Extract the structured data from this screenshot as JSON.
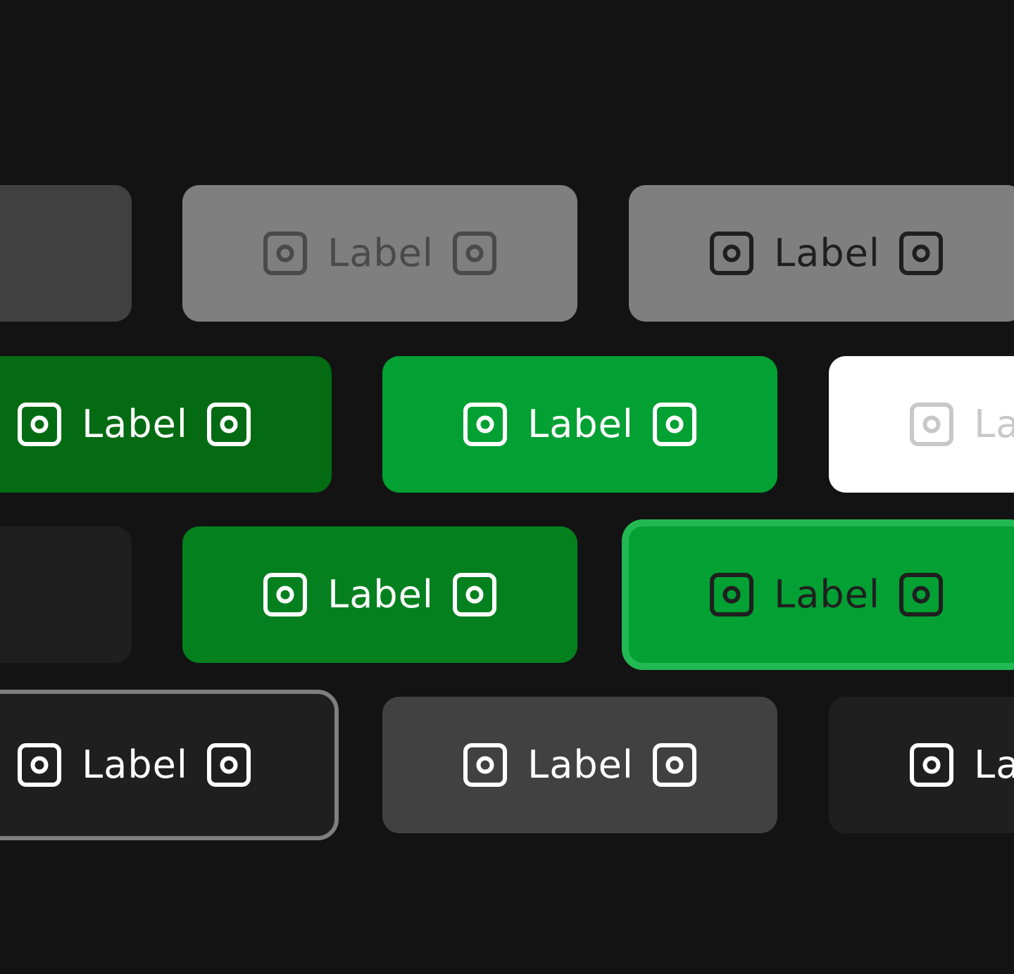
{
  "theme": {
    "background": "#131313",
    "brand_green": "#03a033",
    "brand_green_hover": "#04801f",
    "brand_green_pressed": "#046b13",
    "focus_ring": "#22b853",
    "neutral_disabled": "#7f7f7f",
    "neutral_secondary": "#414141",
    "neutral_tertiary": "#1f1f1f"
  },
  "buttons": [
    {
      "label": "",
      "bg": "#414141",
      "fg": "#cccccc",
      "icon": "square-dot-icon"
    },
    {
      "label": "Label",
      "bg": "#7f7f7f",
      "fg": "#4a4a4a",
      "icon": "square-dot-icon"
    },
    {
      "label": "Label",
      "bg": "#7f7f7f",
      "fg": "#1f1f1f",
      "icon": "square-dot-icon"
    },
    {
      "label": "Label",
      "bg": "#046b13",
      "fg": "#ffffff",
      "icon": "square-dot-icon"
    },
    {
      "label": "Label",
      "bg": "#03a033",
      "fg": "#ffffff",
      "icon": "square-dot-icon"
    },
    {
      "label": "Label",
      "bg": "#ffffff",
      "fg": "#c8c8c8",
      "icon": "square-dot-icon"
    },
    {
      "label": "",
      "bg": "#1f1f1f",
      "fg": "#414141",
      "icon": "square-dot-icon"
    },
    {
      "label": "Label",
      "bg": "#04801f",
      "fg": "#ffffff",
      "icon": "square-dot-icon"
    },
    {
      "label": "Label",
      "bg": "#03a033",
      "fg": "#1f1f1f",
      "border": "#22b853",
      "icon": "square-dot-icon"
    },
    {
      "label": "Label",
      "bg": "#1f1f1f",
      "fg": "#ffffff",
      "border": "#7f7f7f",
      "icon": "square-dot-icon"
    },
    {
      "label": "Label",
      "bg": "#414141",
      "fg": "#ffffff",
      "icon": "square-dot-icon"
    },
    {
      "label": "Label",
      "bg": "#1f1f1f",
      "fg": "#ffffff",
      "icon": "square-dot-icon"
    }
  ]
}
